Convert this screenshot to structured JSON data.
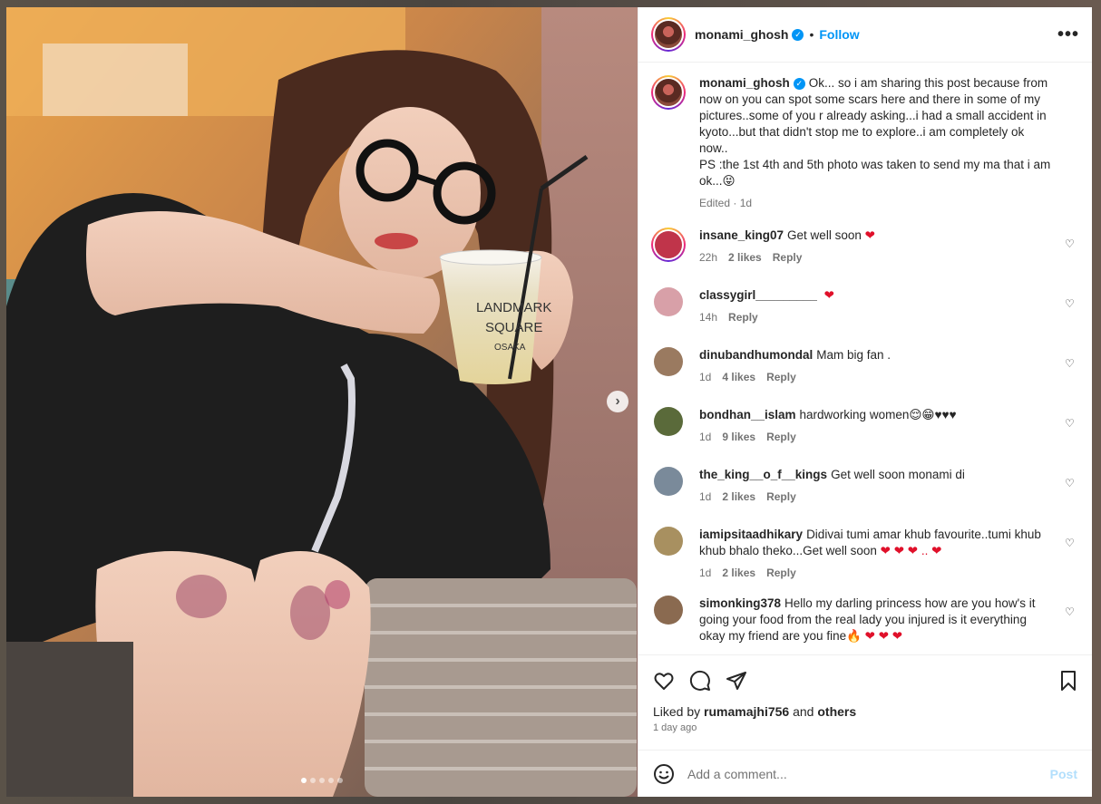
{
  "post": {
    "author": "monami_ghosh",
    "follow_label": "Follow",
    "separator": "•",
    "more_label": "•••"
  },
  "caption": {
    "username": "monami_ghosh",
    "text": "Ok... so i am sharing this post because from now on you can spot some scars here and there in some of my pictures..some of you r already asking...i had a small accident in kyoto...but that didn't stop me to explore..i am completely ok now..",
    "ps": "PS :the 1st 4th and 5th photo was taken to send my ma that i am ok...😝",
    "meta": "Edited · 1d"
  },
  "comments": [
    {
      "username": "insane_king07",
      "text": "Get well soon",
      "heart": "❤",
      "time": "22h",
      "likes": "2 likes",
      "reply": "Reply",
      "avatar_color": "#c0344a"
    },
    {
      "username": "classygirl_________",
      "text": "",
      "heart": "❤",
      "time": "14h",
      "likes": "",
      "reply": "Reply",
      "avatar_color": "#d8a0a8"
    },
    {
      "username": "dinubandhumondal",
      "text": "Mam big fan .",
      "heart": "",
      "time": "1d",
      "likes": "4 likes",
      "reply": "Reply",
      "avatar_color": "#9a7a60"
    },
    {
      "username": "bondhan__islam",
      "text": "hardworking women😌😁♥♥♥",
      "heart": "",
      "time": "1d",
      "likes": "9 likes",
      "reply": "Reply",
      "avatar_color": "#5a6a3a"
    },
    {
      "username": "the_king__o_f__kings",
      "text": "Get well soon monami di",
      "heart": "",
      "time": "1d",
      "likes": "2 likes",
      "reply": "Reply",
      "avatar_color": "#7a8a9a"
    },
    {
      "username": "iamipsitaadhikary",
      "text": "Didivai tumi amar khub favourite..tumi khub khub bhalo theko...Get well soon",
      "heart": "❤ ❤ ❤ .. ❤",
      "time": "1d",
      "likes": "2 likes",
      "reply": "Reply",
      "avatar_color": "#a89060"
    },
    {
      "username": "simonking378",
      "text": "Hello my darling princess how are you how's it going your food from the real lady you injured is it everything okay my friend are you fine🔥",
      "heart": "❤ ❤ ❤",
      "time": "",
      "likes": "",
      "reply": "",
      "avatar_color": "#8a6a50"
    }
  ],
  "actions": {
    "liked_prefix": "Liked by",
    "liked_user": "rumamajhi756",
    "liked_and": "and",
    "liked_others": "others",
    "time_ago": "1 day ago"
  },
  "add_comment": {
    "placeholder": "Add a comment...",
    "post_label": "Post"
  },
  "photo": {
    "cup_text_line1": "LANDMARK",
    "cup_text_line2": "SQUARE",
    "cup_text_line3": "OSAKA",
    "next_label": "›",
    "slides": 5,
    "active_slide": 1
  },
  "colors": {
    "accent": "#0095f6",
    "heart": "#e0102a"
  }
}
